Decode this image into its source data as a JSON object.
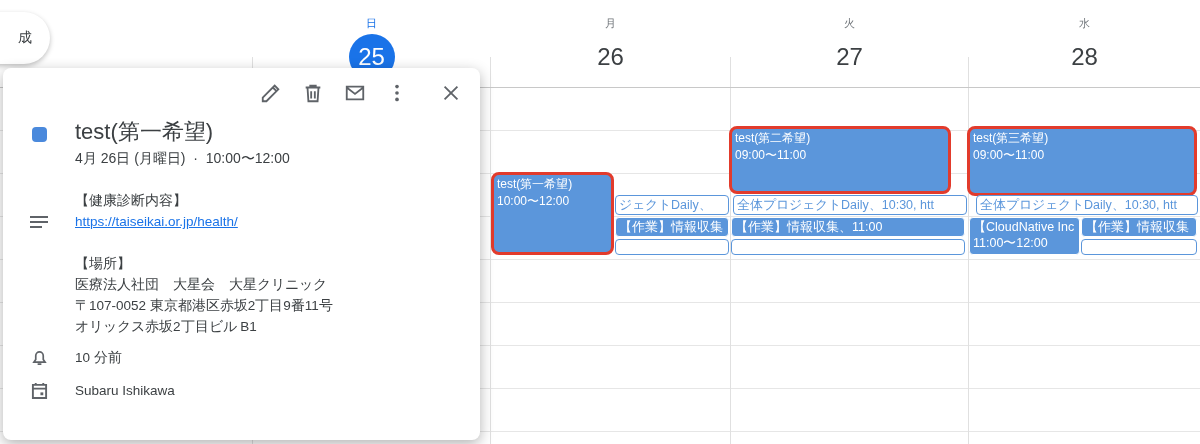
{
  "create_button": {
    "label": "成"
  },
  "days": [
    {
      "weekday": "日",
      "date": "25",
      "selected": true
    },
    {
      "weekday": "月",
      "date": "26",
      "selected": false,
      "events": [
        {
          "kind": "event",
          "title": "test(第一希望)",
          "time": "10:00〜12:00",
          "highlighted": true
        },
        {
          "kind": "outlined",
          "title": "ジェクトDaily、",
          "highlighted": false
        },
        {
          "kind": "event",
          "title": "【作業】情報収集",
          "highlighted": false
        },
        {
          "kind": "outlined",
          "highlighted": false
        }
      ]
    },
    {
      "weekday": "火",
      "date": "27",
      "selected": false,
      "events": [
        {
          "kind": "event",
          "title": "test(第二希望)",
          "time": "09:00〜11:00",
          "highlighted": true
        },
        {
          "kind": "outlined",
          "title": "全体プロジェクトDaily、10:30, htt",
          "highlighted": false
        },
        {
          "kind": "event",
          "title": "【作業】情報収集、11:00",
          "highlighted": false
        },
        {
          "kind": "outlined",
          "highlighted": false
        }
      ]
    },
    {
      "weekday": "水",
      "date": "28",
      "selected": false,
      "events": [
        {
          "kind": "event",
          "title": "test(第三希望)",
          "time": "09:00〜11:00",
          "highlighted": true
        },
        {
          "kind": "outlined",
          "title": "全体プロジェクトDaily、10:30, htt",
          "highlighted": false
        },
        {
          "kind": "event",
          "title": "【CloudNative Inc",
          "time": "11:00〜12:00",
          "highlighted": false
        },
        {
          "kind": "event",
          "title": "【作業】情報収集",
          "highlighted": false
        },
        {
          "kind": "outlined",
          "highlighted": false
        }
      ]
    }
  ],
  "popup": {
    "title": "test(第一希望)",
    "color": "#4a89dc",
    "datetime": "4月 26日 (月曜日)  ·  10:00〜12:00",
    "description": {
      "heading": "【健康診断内容】",
      "link": "https://taiseikai.or.jp/health/"
    },
    "location": {
      "heading": "【場所】",
      "lines": [
        "医療法人社団　大星会　大星クリニック",
        "〒107-0052 東京都港区赤坂2丁目9番11号",
        "オリックス赤坂2丁目ビル B1"
      ]
    },
    "reminder": "10 分前",
    "calendar": "Subaru Ishikawa"
  }
}
